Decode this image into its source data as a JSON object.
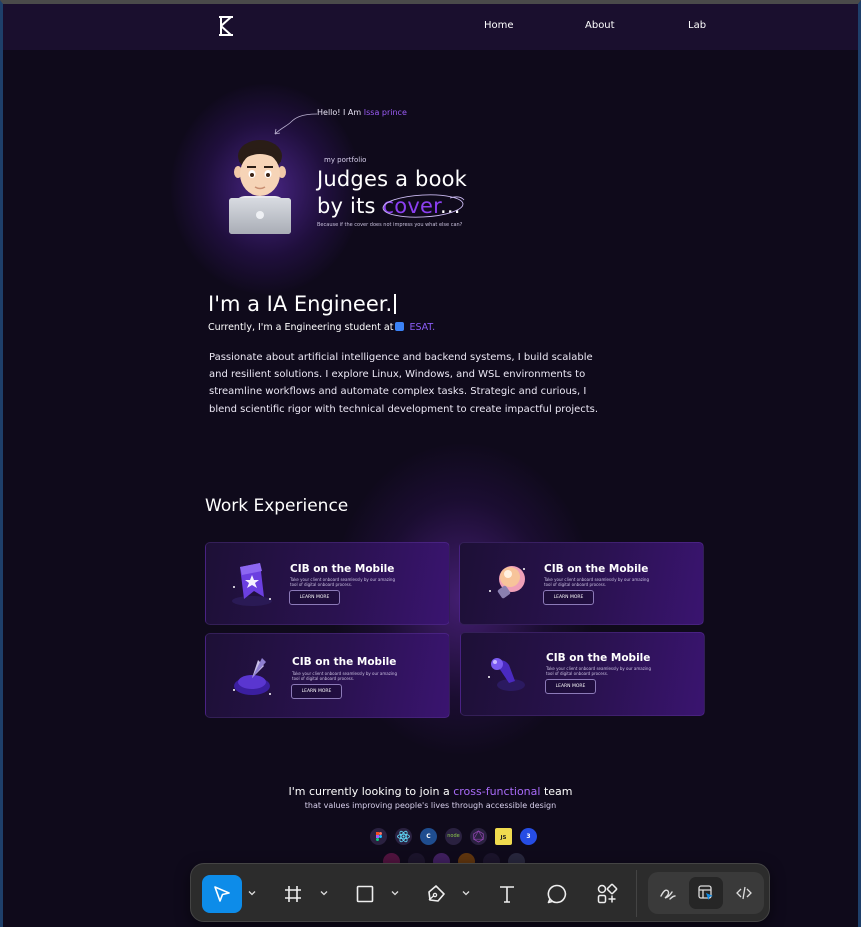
{
  "nav": {
    "logo_icon": "k-monogram-icon",
    "links": [
      "Home",
      "About",
      "Lab"
    ]
  },
  "hero": {
    "hello_prefix": "Hello! I Am ",
    "hello_name": "Issa prince",
    "my_portfolio": "my portfolio",
    "headline_line1": "Judges a book",
    "headline_line2_prefix": "by its ",
    "headline_highlight": "cover",
    "headline_suffix": "...",
    "tagline": "Because if the cover does not impress you what else can?"
  },
  "intro": {
    "title": "I'm a IA Engineer.",
    "currently_prefix": "Currently, I'm a Engineering student at",
    "school": " ESAT.",
    "bio": "Passionate about artificial intelligence and backend systems, I build scalable and resilient solutions. I explore Linux, Windows, and WSL environments to streamline workflows and automate complex tasks. Strategic and curious, I blend scientific rigor with technical development to create impactful projects."
  },
  "work": {
    "title": "Work Experience",
    "cards": [
      {
        "title": "CIB on the Mobile",
        "desc": "Take your client onboard seamlessly by our amazing tool of digital onboard process.",
        "button": "LEARN MORE",
        "icon": "star-badge-icon"
      },
      {
        "title": "CIB on the Mobile",
        "desc": "Take your client onboard seamlessly by our amazing tool of digital onboard process.",
        "button": "LEARN MORE",
        "icon": "lightbulb-icon"
      },
      {
        "title": "CIB on the Mobile",
        "desc": "Take your client onboard seamlessly by our amazing tool of digital onboard process.",
        "button": "LEARN MORE",
        "icon": "rocket-icon"
      },
      {
        "title": "CIB on the Mobile",
        "desc": "Take your client onboard seamlessly by our amazing tool of digital onboard process.",
        "button": "LEARN MORE",
        "icon": "joystick-icon"
      }
    ]
  },
  "cta": {
    "line1_prefix": "I'm currently looking to join a ",
    "line1_highlight": "cross-functional",
    "line1_suffix": " team",
    "line2": "that values improving people's lives through accessible design",
    "tech_icons": [
      "figma-icon",
      "react-icon",
      "c-icon",
      "node-icon",
      "graphql-icon",
      "js-icon",
      "css3-icon"
    ],
    "tech_labels": {
      "node": "node",
      "js": "JS",
      "css3": "3",
      "c": "C"
    }
  },
  "toolbar": {
    "tools": [
      "move-tool-icon",
      "frame-tool-icon",
      "rectangle-tool-icon",
      "pen-tool-icon",
      "text-tool-icon",
      "comment-tool-icon",
      "actions-tool-icon"
    ],
    "modes": [
      "draw-mode-icon",
      "design-mode-icon",
      "dev-mode-icon"
    ],
    "active_tool": "move-tool-icon",
    "active_mode": "design-mode-icon",
    "accent": "#0d8ce9"
  },
  "colors": {
    "background": "#0f0a1b",
    "nav": "#1a0f2e",
    "accent_purple": "#8b3ff0"
  }
}
